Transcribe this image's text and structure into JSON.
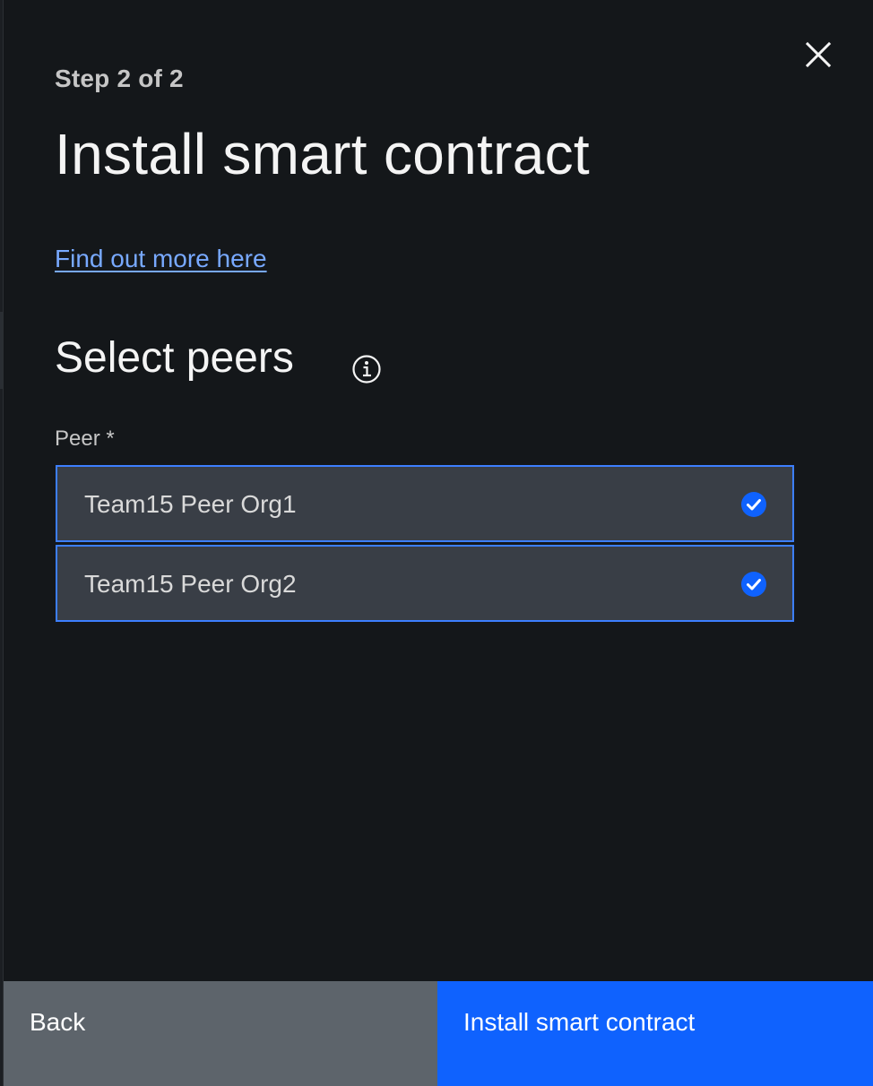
{
  "panel": {
    "step": "Step 2 of 2",
    "title": "Install smart contract",
    "learn_more_link": "Find out more here",
    "section_title": "Select peers",
    "field_label": "Peer *"
  },
  "peers": [
    {
      "name": "Team15 Peer Org1",
      "selected": true
    },
    {
      "name": "Team15 Peer Org2",
      "selected": true
    }
  ],
  "footer": {
    "back_label": "Back",
    "primary_label": "Install smart contract"
  },
  "icons": {
    "close": "close-icon",
    "info": "info-icon",
    "check": "checkmark-filled-icon"
  },
  "colors": {
    "accent": "#0f62fe",
    "link": "#78a9ff",
    "selected_border": "#3d7fff",
    "panel_bg": "#14171a",
    "tile_bg": "#393e46",
    "secondary_button": "#5d646b"
  }
}
